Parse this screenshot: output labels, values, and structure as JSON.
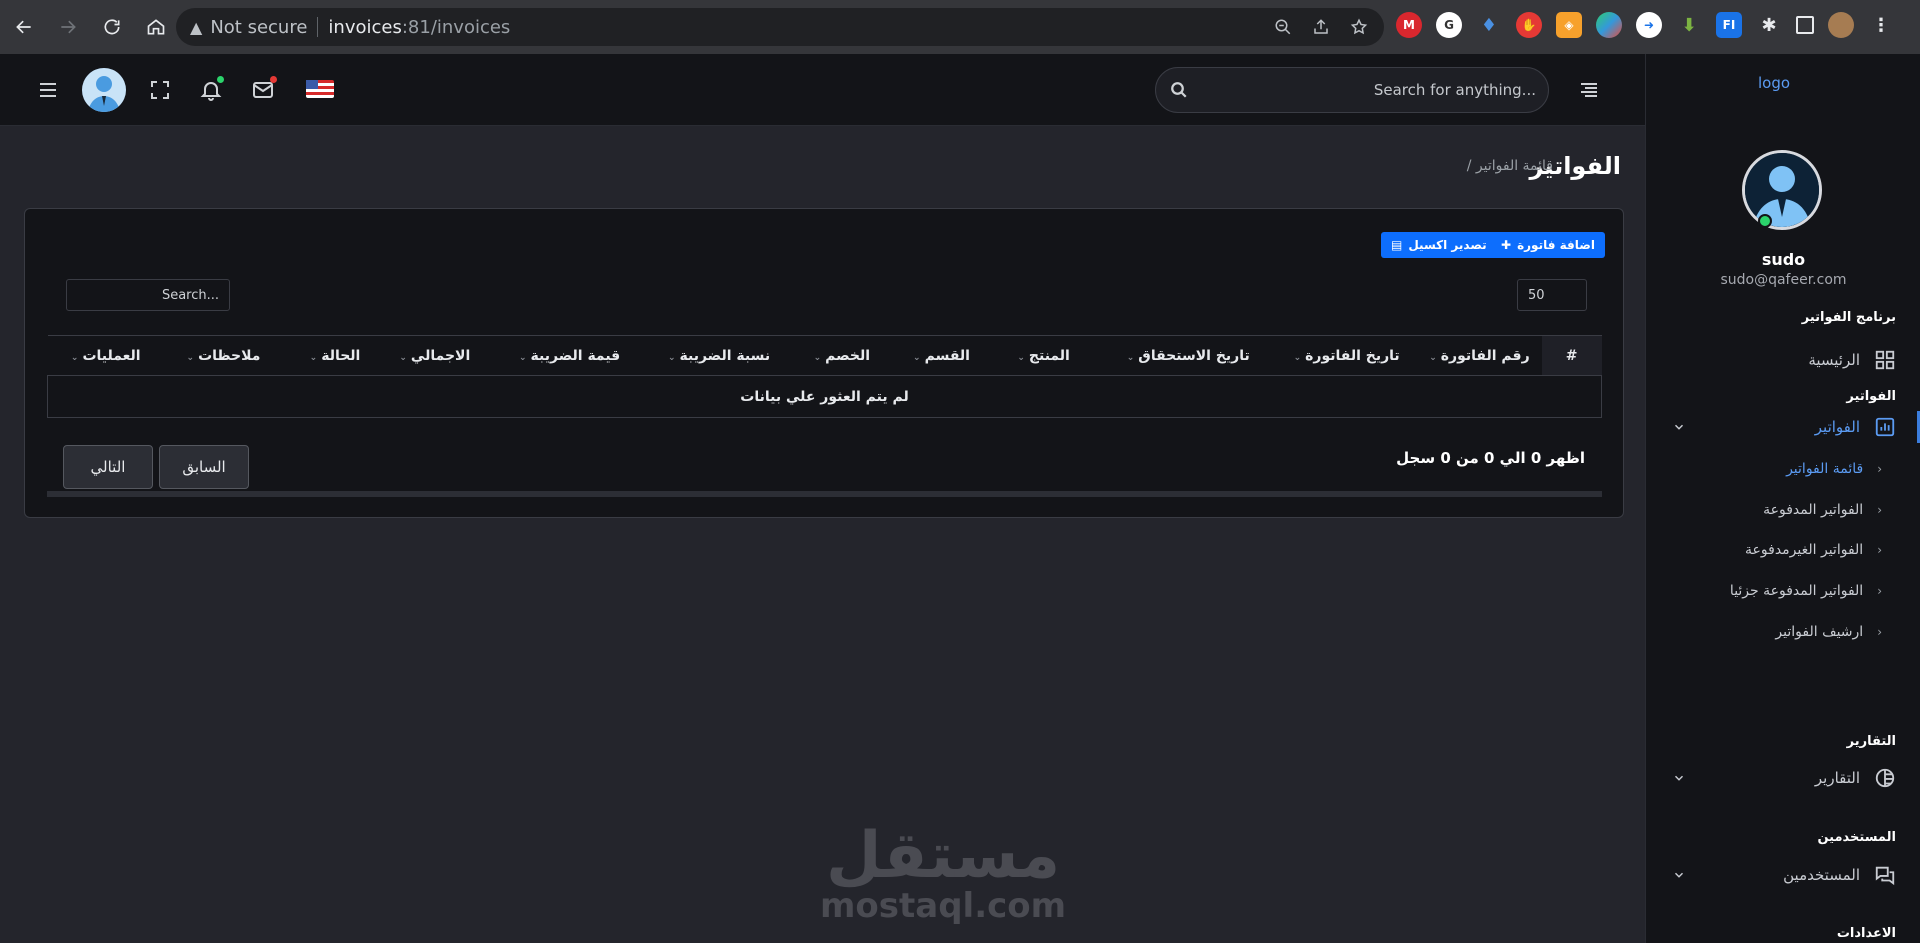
{
  "browser": {
    "security_label": "Not secure",
    "url_host": "invoices",
    "url_path": ":81/invoices"
  },
  "topbar": {
    "search_placeholder": "Search for anything...",
    "notification_dot_color": "#2bd36b",
    "mail_dot_color": "#e53935"
  },
  "sidebar": {
    "logo_text": "logo",
    "user_name": "sudo",
    "user_email": "sudo@qafeer.com",
    "section_app": "برنامج الفواتير",
    "home_label": "الرئيسية",
    "section_invoices": "الفواتير",
    "invoices_label": "الفواتير",
    "sub_items": [
      {
        "label": "قائمة الفواتير"
      },
      {
        "label": "الفواتير المدفوعة"
      },
      {
        "label": "الفواتير الغيرمدفوعة"
      },
      {
        "label": "الفواتير المدفوعة جزئيا"
      },
      {
        "label": "ارشيف الفواتير"
      }
    ],
    "section_reports": "التقارير",
    "reports_label": "التقارير",
    "section_users": "المستخدمين",
    "users_label": "المستخدمين",
    "section_settings": "الاعدادات"
  },
  "page": {
    "title": "الفواتير",
    "breadcrumb": "/ قائمة الفواتير",
    "add_invoice": "اضافة فاتورة",
    "export_excel": "تصدير اكسيل",
    "page_length": "50",
    "table_search_placeholder": "Search...",
    "columns": [
      "#",
      "رقم الفاتورة",
      "تاريخ الفاتورة",
      "تاريخ الاستحقاق",
      "المنتج",
      "القسم",
      "الخصم",
      "نسبة الضريبة",
      "قيمة الضريبة",
      "الاجمالي",
      "الحالة",
      "ملاحظات",
      "العمليات"
    ],
    "empty_message": "لم يتم العثور علي بيانات",
    "info_text": "اظهر 0 الي 0 من 0 سجل",
    "prev_label": "السابق",
    "next_label": "التالي"
  },
  "watermark": {
    "arabic": "مستقل",
    "latin": "mostaql.com"
  },
  "colors": {
    "accent": "#0d6efd",
    "link": "#5b9bf2"
  }
}
